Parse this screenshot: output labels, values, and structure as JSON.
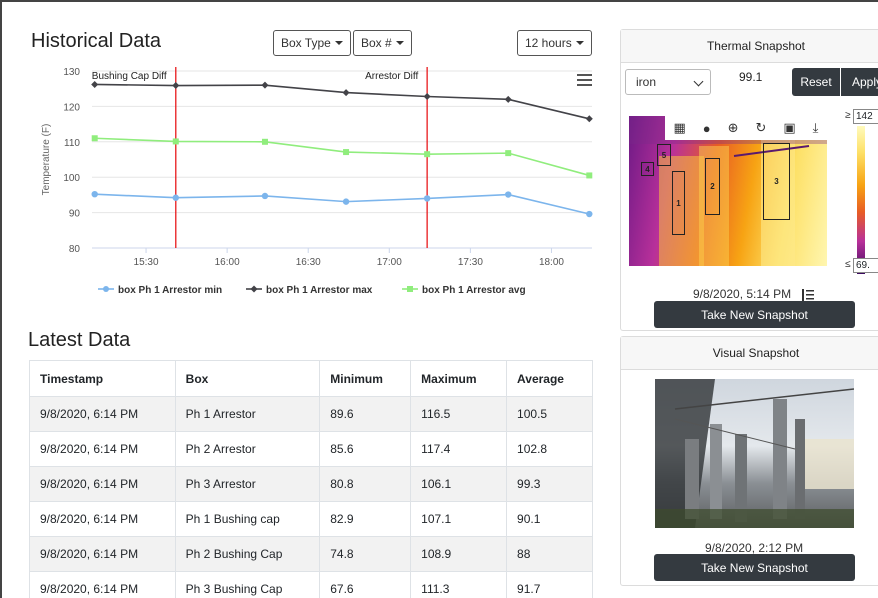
{
  "header": {
    "title": "Historical Data",
    "box_type_label": "Box Type",
    "box_num_label": "Box #",
    "range_label": "12 hours"
  },
  "chart_data": {
    "type": "line",
    "ylabel": "Temperature (F)",
    "xlabel": "",
    "ylim": [
      80,
      130
    ],
    "yticks": [
      80,
      90,
      100,
      110,
      120,
      130
    ],
    "xlim": [
      "15:10",
      "18:15"
    ],
    "xticks": [
      "15:30",
      "16:00",
      "16:30",
      "17:00",
      "17:30",
      "18:00"
    ],
    "grid": true,
    "legend": "bottom",
    "annotations": [
      {
        "label": "Bushing Cap Diff",
        "x": "15:41"
      },
      {
        "label": "Arrestor Diff",
        "x": "17:14"
      }
    ],
    "series": [
      {
        "name": "box Ph 1 Arrestor min",
        "color": "#7cb5ec",
        "marker": "circle",
        "x": [
          "15:11",
          "15:41",
          "16:14",
          "16:44",
          "17:14",
          "17:44",
          "18:14"
        ],
        "y": [
          95.2,
          94.2,
          94.7,
          93.1,
          94.0,
          95.1,
          89.6
        ]
      },
      {
        "name": "box Ph 1 Arrestor max",
        "color": "#434348",
        "marker": "diamond",
        "x": [
          "15:11",
          "15:41",
          "16:14",
          "16:44",
          "17:14",
          "17:44",
          "18:14"
        ],
        "y": [
          126.2,
          125.9,
          126.0,
          123.9,
          122.8,
          122.0,
          116.5
        ]
      },
      {
        "name": "box Ph 1 Arrestor avg",
        "color": "#90ed7d",
        "marker": "square",
        "x": [
          "15:11",
          "15:41",
          "16:14",
          "16:44",
          "17:14",
          "17:44",
          "18:14"
        ],
        "y": [
          111.0,
          110.1,
          110.0,
          107.1,
          106.5,
          106.8,
          100.5
        ]
      }
    ]
  },
  "latest": {
    "title": "Latest Data",
    "columns": [
      "Timestamp",
      "Box",
      "Minimum",
      "Maximum",
      "Average"
    ],
    "rows": [
      [
        "9/8/2020, 6:14 PM",
        "Ph 1 Arrestor",
        "89.6",
        "116.5",
        "100.5"
      ],
      [
        "9/8/2020, 6:14 PM",
        "Ph 2 Arrestor",
        "85.6",
        "117.4",
        "102.8"
      ],
      [
        "9/8/2020, 6:14 PM",
        "Ph 3 Arrestor",
        "80.8",
        "106.1",
        "99.3"
      ],
      [
        "9/8/2020, 6:14 PM",
        "Ph 1 Bushing cap",
        "82.9",
        "107.1",
        "90.1"
      ],
      [
        "9/8/2020, 6:14 PM",
        "Ph 2 Bushing Cap",
        "74.8",
        "108.9",
        "88"
      ],
      [
        "9/8/2020, 6:14 PM",
        "Ph 3 Bushing Cap",
        "67.6",
        "111.3",
        "91.7"
      ]
    ]
  },
  "thermal": {
    "title": "Thermal Snapshot",
    "palette": "iron",
    "value": "99.1",
    "reset_label": "Reset",
    "apply_label": "Apply",
    "scale_max": "142",
    "scale_min": "69.",
    "ge_sign": "≥",
    "le_sign": "≤",
    "box_labels": [
      "1",
      "2",
      "3",
      "4",
      "5"
    ],
    "date": "9/8/2020, 5:14 PM",
    "button_label": "Take New Snapshot"
  },
  "visual": {
    "title": "Visual Snapshot",
    "date": "9/8/2020, 2:12 PM",
    "button_label": "Take New Snapshot"
  }
}
